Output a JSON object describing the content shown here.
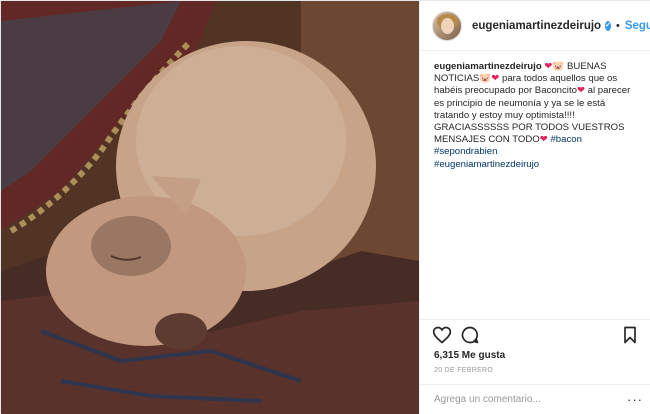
{
  "post": {
    "username": "eugeniamartinezdeirujo",
    "follow_label": "Seguir",
    "separator": "•",
    "verified_mark": "✓",
    "caption": {
      "username": "eugeniamartinezdeirujo",
      "heart": "❤",
      "pig": "🐷",
      "part1": "BUENAS NOTICIAS",
      "part2": "para todos aquellos que os habéis preocupado por Baconcito",
      "part3": "al parecer es principio de neumonía y ya se le está tratando y estoy muy optimista!!!! GRACIASSSSSS POR TODOS VUESTROS MENSAJES CON TODO",
      "tags": [
        "#bacon",
        "#sepondrabien",
        "#eugeniamartinezdeirujo"
      ]
    },
    "likes": "6,315 Me gusta",
    "date": "20 DE FEBRERO",
    "comment_placeholder": "Agrega un comentario...",
    "more_label": "···"
  },
  "icons": {
    "like": "heart-outline-icon",
    "comment": "comment-bubble-icon",
    "save": "bookmark-icon"
  },
  "colors": {
    "link": "#3897f0",
    "hashtag": "#003569",
    "heart": "#e0245e",
    "text": "#262626",
    "muted": "#999999"
  }
}
